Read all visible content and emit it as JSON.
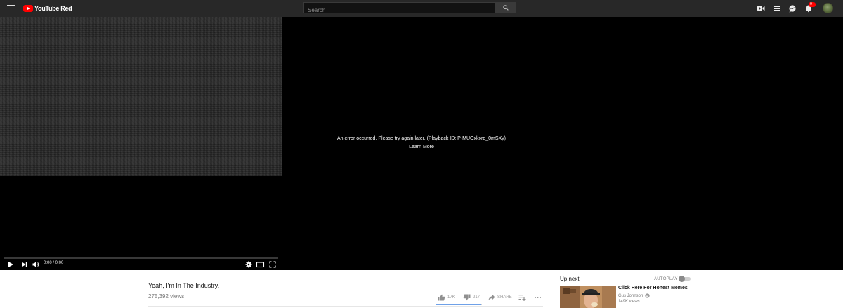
{
  "masthead": {
    "logo_text": "YouTube Red",
    "search_placeholder": "Search",
    "notification_badge": "9+",
    "icons": [
      "menu-icon",
      "youtube-logo-icon",
      "search-icon",
      "video-camera-icon",
      "apps-grid-icon",
      "messages-icon",
      "bell-icon",
      "avatar"
    ]
  },
  "player": {
    "error_message": "An error occurred. Please try again later. (Playback ID: P-MUOxkxrd_0mSXy)",
    "learn_more": "Learn More",
    "time": "0:00 / 0:00",
    "progress": 0,
    "icons": [
      "play-icon",
      "next-icon",
      "volume-icon",
      "settings-gear-icon",
      "theater-mode-icon",
      "fullscreen-icon"
    ]
  },
  "video": {
    "title": "Yeah, I'm In The Industry.",
    "views": "275,392 views",
    "likes": "17K",
    "dislikes": "217",
    "share_label": "SHARE",
    "like_ratio": 0.987
  },
  "sidebar": {
    "up_next": "Up next",
    "autoplay_label": "AUTOPLAY",
    "autoplay_on": false,
    "recommendation": {
      "title": "Click Here For Honest Memes",
      "channel": "Gus Johnson",
      "views": "149K views"
    }
  },
  "colors": {
    "masthead": "#282828",
    "logo_red": "#ff0000",
    "player_bg": "#000000",
    "like_bar": "#6fa1e8"
  }
}
